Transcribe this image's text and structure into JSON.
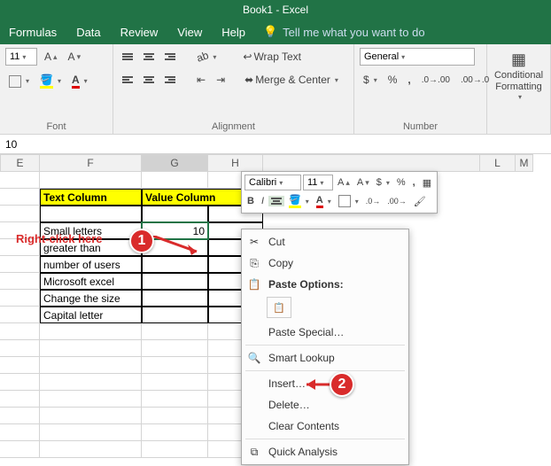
{
  "title": "Book1  -  Excel",
  "menubar": {
    "formulas": "Formulas",
    "data": "Data",
    "review": "Review",
    "view": "View",
    "help": "Help",
    "tellme": "Tell me what you want to do"
  },
  "ribbon": {
    "font_label": "Font",
    "font_size": "11",
    "alignment_label": "Alignment",
    "wrap_text": "Wrap Text",
    "merge_center": "Merge & Center",
    "number_label": "Number",
    "number_format": "General",
    "cond_fmt": "Conditional Formatting"
  },
  "formula_val": "10",
  "cols": {
    "E": "E",
    "F": "F",
    "G": "G",
    "H": "H",
    "L": "L",
    "M": "M"
  },
  "table": {
    "h1": "Text Column",
    "h2": "Value Column",
    "r1": "Small letters",
    "v1": "10",
    "r2": "greater than",
    "r3": "number of users",
    "r4": "Microsoft excel",
    "r5": "Change the size",
    "r6": "Capital letter"
  },
  "mini": {
    "font": "Calibri",
    "size": "11"
  },
  "ctx": {
    "cut": "Cut",
    "copy": "Copy",
    "paste_opts": "Paste Options:",
    "paste_special": "Paste Special…",
    "smart_lookup": "Smart Lookup",
    "insert": "Insert…",
    "delete": "Delete…",
    "clear": "Clear Contents",
    "quick": "Quick Analysis"
  },
  "annot": {
    "rightclick": "Right-click here",
    "b1": "1",
    "b2": "2"
  }
}
